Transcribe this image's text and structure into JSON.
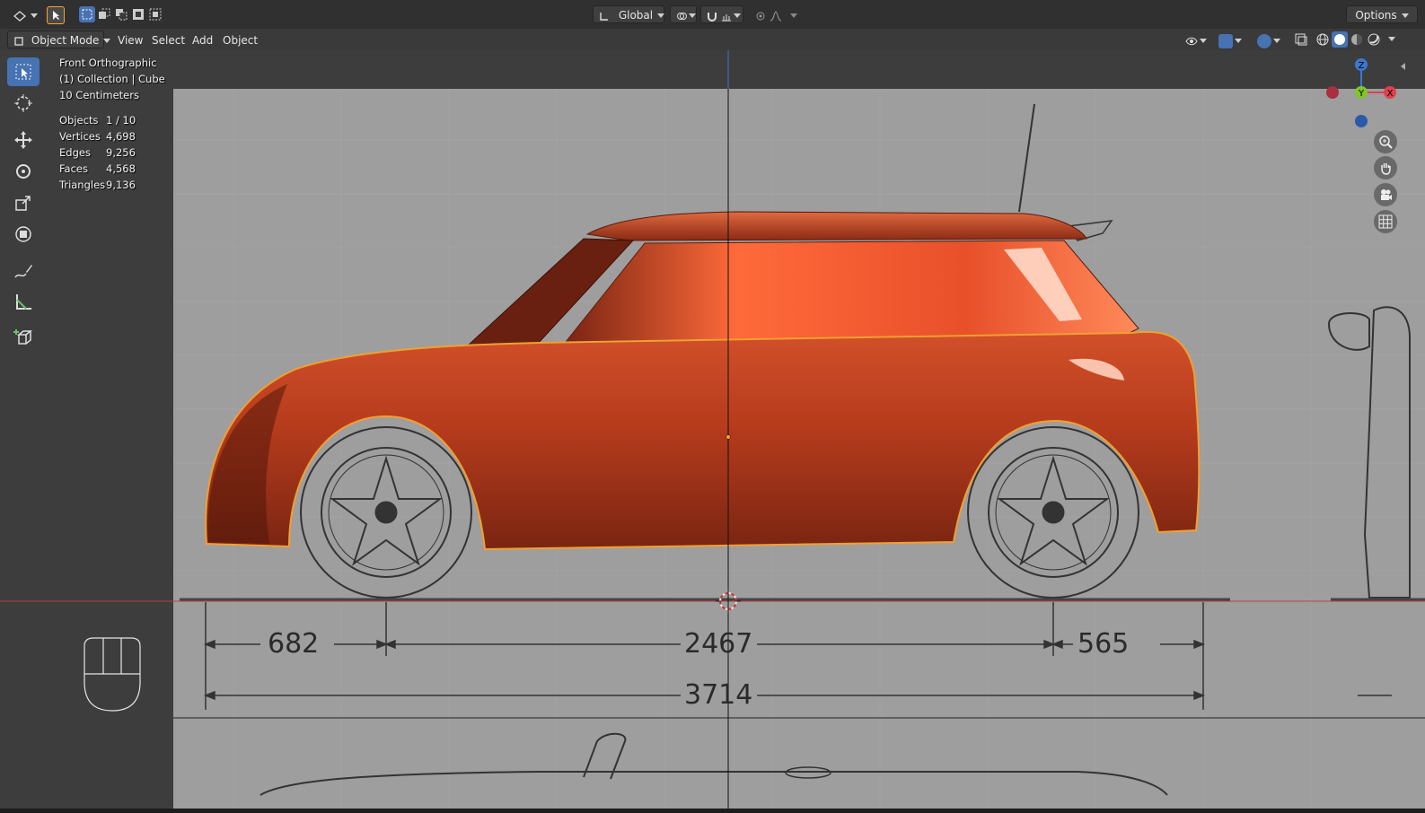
{
  "header": {
    "transform_orientation": "Global",
    "options_label": "Options"
  },
  "menu": {
    "mode": "Object Mode",
    "items": [
      "View",
      "Select",
      "Add",
      "Object"
    ]
  },
  "viewport_info": {
    "view": "Front Orthographic",
    "collection": "(1) Collection | Cube",
    "scale": "10 Centimeters"
  },
  "stats": [
    {
      "label": "Objects",
      "value": "1 / 10"
    },
    {
      "label": "Vertices",
      "value": "4,698"
    },
    {
      "label": "Edges",
      "value": "9,256"
    },
    {
      "label": "Faces",
      "value": "4,568"
    },
    {
      "label": "Triangles",
      "value": "9,136"
    }
  ],
  "blueprint_dims": {
    "front_overhang": "682",
    "wheelbase": "2467",
    "rear_overhang": "565",
    "total_length": "3714"
  },
  "gizmo": {
    "z": "Z",
    "y": "Y",
    "x": "X"
  },
  "colors": {
    "accent": "#4772b3",
    "selection_outline": "#f0a030",
    "car_body": "#b83a1c",
    "x_axis": "#e0404e",
    "y_axis": "#7ec62a",
    "z_axis": "#3a78d0"
  },
  "icons": {
    "editor_type": "view3d-icon",
    "select_tool": "cursor-icon",
    "cursor_tool": "3d-cursor-icon",
    "move_tool": "move-icon",
    "rotate_tool": "rotate-icon",
    "scale_tool": "scale-icon",
    "transform_tool": "transform-icon",
    "annotate_tool": "annotate-icon",
    "measure_tool": "measure-icon",
    "add_cube_tool": "add-cube-icon",
    "zoom": "zoom-icon",
    "pan": "hand-icon",
    "camera": "camera-icon",
    "ortho": "grid-icon"
  }
}
